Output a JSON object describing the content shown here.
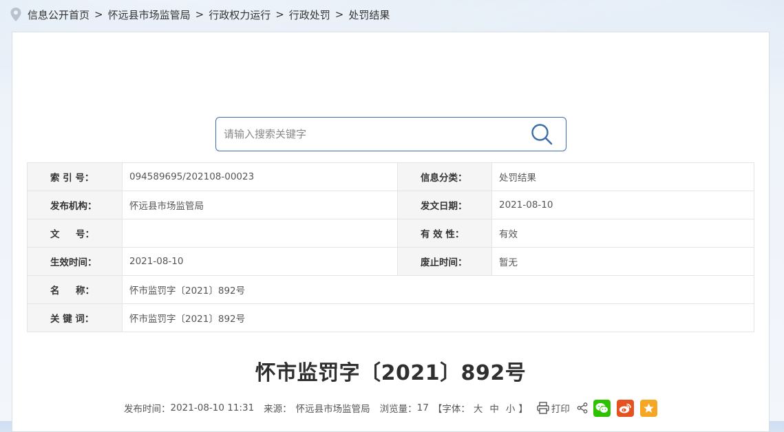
{
  "breadcrumb": {
    "items": [
      "信息公开首页",
      "怀远县市场监管局",
      "行政权力运行",
      "行政处罚",
      "处罚结果"
    ],
    "separator": ">"
  },
  "search": {
    "placeholder": "请输入搜索关键字",
    "value": ""
  },
  "meta": {
    "index_label": "索 引 号：",
    "index_value": "094589695/202108-00023",
    "category_label": "信息分类：",
    "category_value": "处罚结果",
    "publisher_label": "发布机构：",
    "publisher_value": "怀远县市场监管局",
    "date_label": "发文日期：",
    "date_value": "2021-08-10",
    "docno_label": "文     号：",
    "docno_value": "",
    "validity_label": "有 效 性：",
    "validity_value": "有效",
    "effective_label": "生效时间：",
    "effective_value": "2021-08-10",
    "abolish_label": "废止时间：",
    "abolish_value": "暂无",
    "name_label": "名     称：",
    "name_value": "怀市监罚字〔2021〕892号",
    "keywords_label": "关 键 词：",
    "keywords_value": "怀市监罚字〔2021〕892号"
  },
  "article": {
    "title": "怀市监罚字〔2021〕892号",
    "publish_time_label": "发布时间：",
    "publish_time": "2021-08-10 11:31",
    "source_label": "来源：",
    "source": "怀远县市场监管局",
    "views_label": "浏览量：",
    "views": "17",
    "font_label": "【字体：",
    "font_large": "大",
    "font_medium": "中",
    "font_small": "小",
    "font_close": "】",
    "print_label": "打印"
  },
  "colors": {
    "accent": "#3d6da8",
    "wechat": "#2dc100",
    "weibo": "#e6521f",
    "favorite": "#f5a623"
  },
  "icons": [
    "location-pin-icon",
    "search-icon",
    "printer-icon",
    "share-icon",
    "wechat-icon",
    "weibo-icon",
    "star-icon"
  ]
}
